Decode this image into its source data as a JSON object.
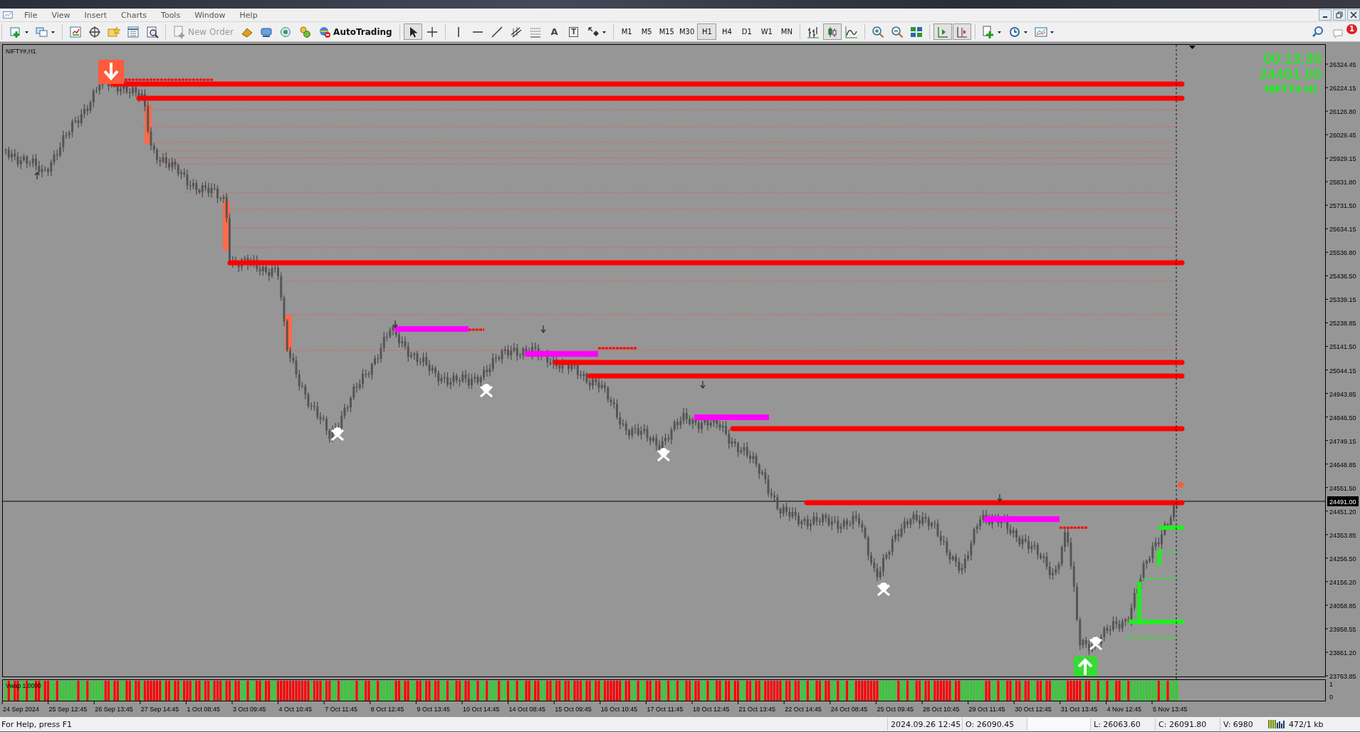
{
  "menu": [
    "File",
    "View",
    "Insert",
    "Charts",
    "Tools",
    "Window",
    "Help"
  ],
  "toolbar": {
    "new_order": {
      "label": "New Order",
      "disabled": true
    },
    "autotrading": {
      "label": "AutoTrading"
    },
    "text_tool_glyph": "A",
    "label_tool_glyph": "T",
    "drawing_tools": [
      {
        "selected": true
      },
      {
        "selected": false
      }
    ],
    "timeframes": [
      {
        "label": "M1",
        "selected": false
      },
      {
        "label": "M5",
        "selected": false
      },
      {
        "label": "M15",
        "selected": false
      },
      {
        "label": "M30",
        "selected": false
      },
      {
        "label": "H1",
        "selected": true
      },
      {
        "label": "H4",
        "selected": false
      },
      {
        "label": "D1",
        "selected": false
      },
      {
        "label": "W1",
        "selected": false
      },
      {
        "label": "MN",
        "selected": false
      }
    ],
    "chart_types": [
      {
        "selected": false
      },
      {
        "selected": true
      },
      {
        "selected": false
      }
    ],
    "autoscroll": {
      "on": true
    },
    "chart_shift": {
      "on": true
    },
    "notification_count": "1"
  },
  "chart": {
    "symbol_label": "NIFTY#,H1",
    "timer": "00:13:36",
    "price_display": "24491.00",
    "symbol_timeframe": "NIFTY#  H1",
    "price_axis": [
      "26324.45",
      "26224.15",
      "26126.80",
      "26029.45",
      "25929.15",
      "25831.80",
      "25731.50",
      "25634.15",
      "25536.80",
      "25436.50",
      "25339.15",
      "25238.85",
      "25141.50",
      "25044.15",
      "24943.85",
      "24846.50",
      "24749.15",
      "24648.85",
      "24551.50",
      "24451.20",
      "24353.85",
      "24256.50",
      "24156.20",
      "24058.85",
      "23958.55",
      "23861.20",
      "23763.85"
    ],
    "current_price": "24491.00",
    "indicator": {
      "label": "Vwap 1.0000",
      "axis": [
        "1",
        "0"
      ]
    },
    "time_axis": [
      "24 Sep 2024",
      "25 Sep 12:45",
      "26 Sep 13:45",
      "27 Sep 14:45",
      "1 Oct 08:45",
      "3 Oct 09:45",
      "4 Oct 10:45",
      "7 Oct 11:45",
      "8 Oct 12:45",
      "9 Oct 13:45",
      "10 Oct 14:45",
      "14 Oct 08:45",
      "15 Oct 09:45",
      "16 Oct 10:45",
      "17 Oct 11:45",
      "18 Oct 12:45",
      "21 Oct 13:45",
      "22 Oct 14:45",
      "24 Oct 08:45",
      "25 Oct 09:45",
      "28 Oct 10:45",
      "29 Oct 11:45",
      "30 Oct 12:45",
      "31 Oct 13:45",
      "4 Nov 12:45",
      "5 Nov 13:45"
    ]
  },
  "status_bar": {
    "help": "For Help, press F1",
    "date": "2024.09.26 12:45",
    "open": "O: 26090.45",
    "low": "L: 26063.60",
    "close": "C: 26091.80",
    "volume": "V: 6980",
    "traffic": "472/1 kb"
  }
}
